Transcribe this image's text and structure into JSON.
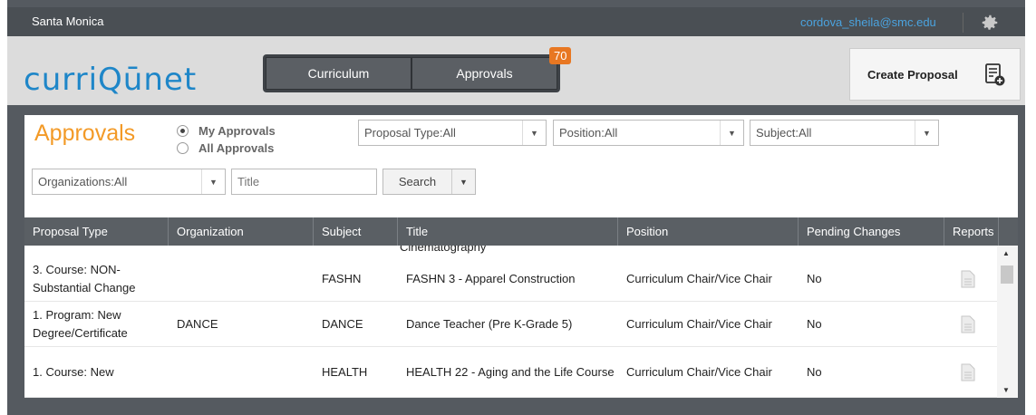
{
  "topbar": {
    "campus": "Santa Monica",
    "user_email": "cordova_sheila@smc.edu",
    "settings_icon": "gear-icon"
  },
  "header": {
    "logo": "curriQūnet",
    "tabs": [
      {
        "label": "Curriculum"
      },
      {
        "label": "Approvals"
      }
    ],
    "approvals_badge": "70",
    "create_proposal_label": "Create Proposal",
    "create_proposal_icon": "document-add-icon"
  },
  "approvals": {
    "title": "Approvals",
    "radio_options": [
      {
        "label": "My Approvals",
        "selected": true
      },
      {
        "label": "All Approvals",
        "selected": false
      }
    ],
    "filters": {
      "proposal_type": "Proposal Type:All",
      "position": "Position:All",
      "subject": "Subject:All",
      "organizations": "Organizations:All",
      "title_placeholder": "Title",
      "search_label": "Search"
    }
  },
  "table": {
    "columns": [
      "Proposal Type",
      "Organization",
      "Subject",
      "Title",
      "Position",
      "Pending Changes",
      "Reports"
    ],
    "partial_row_title": "Cinematography",
    "rows": [
      {
        "proposal_type": "3. Course: NON-Substantial Change",
        "organization": "",
        "subject": "FASHN",
        "title": "FASHN 3 - Apparel Construction",
        "position": "Curriculum Chair/Vice Chair",
        "pending": "No"
      },
      {
        "proposal_type": "1. Program: New Degree/Certificate",
        "organization": "DANCE",
        "subject": "DANCE",
        "title": "Dance Teacher (Pre K-Grade 5)",
        "position": "Curriculum Chair/Vice Chair",
        "pending": "No"
      },
      {
        "proposal_type": "1. Course: New",
        "organization": "",
        "subject": "HEALTH",
        "title": "HEALTH 22 - Aging and the Life Course",
        "position": "Curriculum Chair/Vice Chair",
        "pending": "No"
      }
    ]
  },
  "colors": {
    "accent_orange": "#f39a27",
    "logo_blue": "#1e86c8",
    "badge_orange": "#e87722",
    "dark_bar": "#4a4f54"
  }
}
